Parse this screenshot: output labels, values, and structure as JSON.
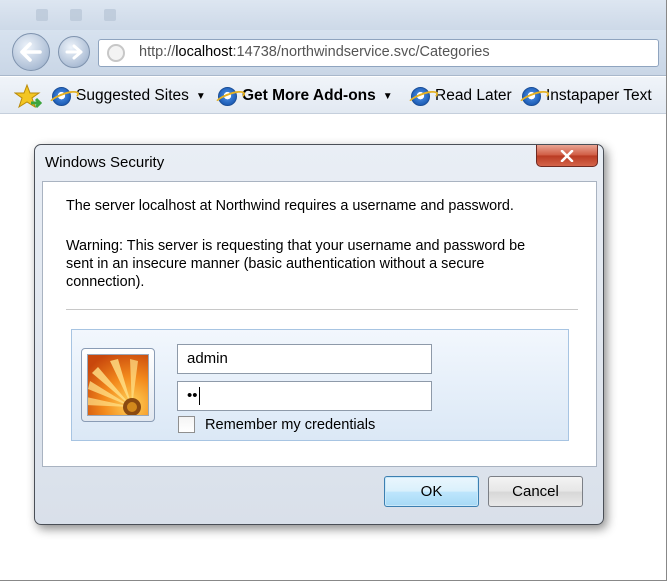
{
  "browser": {
    "address_bar": {
      "prefix": "http://",
      "host": "localhost",
      "rest": ":14738/northwindservice.svc/Categories"
    },
    "favorites_bar": {
      "items": [
        {
          "label": "Suggested Sites",
          "has_dropdown": true,
          "bold": false
        },
        {
          "label": "Get More Add-ons",
          "has_dropdown": true,
          "bold": true
        },
        {
          "label": "Read Later",
          "has_dropdown": false,
          "bold": false
        },
        {
          "label": "Instapaper Text",
          "has_dropdown": false,
          "bold": false
        }
      ]
    }
  },
  "dialog": {
    "title": "Windows Security",
    "close_label": "X",
    "message": "The server localhost at Northwind requires a username and password.",
    "warning_lines": [
      "Warning: This server is requesting that your username and password be",
      "sent in an insecure manner (basic authentication without a secure",
      "connection)."
    ],
    "username_value": "admin",
    "password_mask": "••",
    "remember_label": "Remember my credentials",
    "remember_checked": false,
    "ok_label": "OK",
    "cancel_label": "Cancel"
  },
  "icons": {
    "back": "back-arrow-icon",
    "forward": "forward-arrow-icon",
    "page": "page-loading-icon",
    "favorites": "favorites-star-icon",
    "ie": "internet-explorer-icon",
    "user_tile": "flower-user-picture",
    "close": "close-icon"
  },
  "colors": {
    "chrome_bg": "#cdd9e8",
    "close_button": "#c94a31",
    "ok_button": "#bee6fd",
    "panel_bg": "#dbe8f6"
  }
}
